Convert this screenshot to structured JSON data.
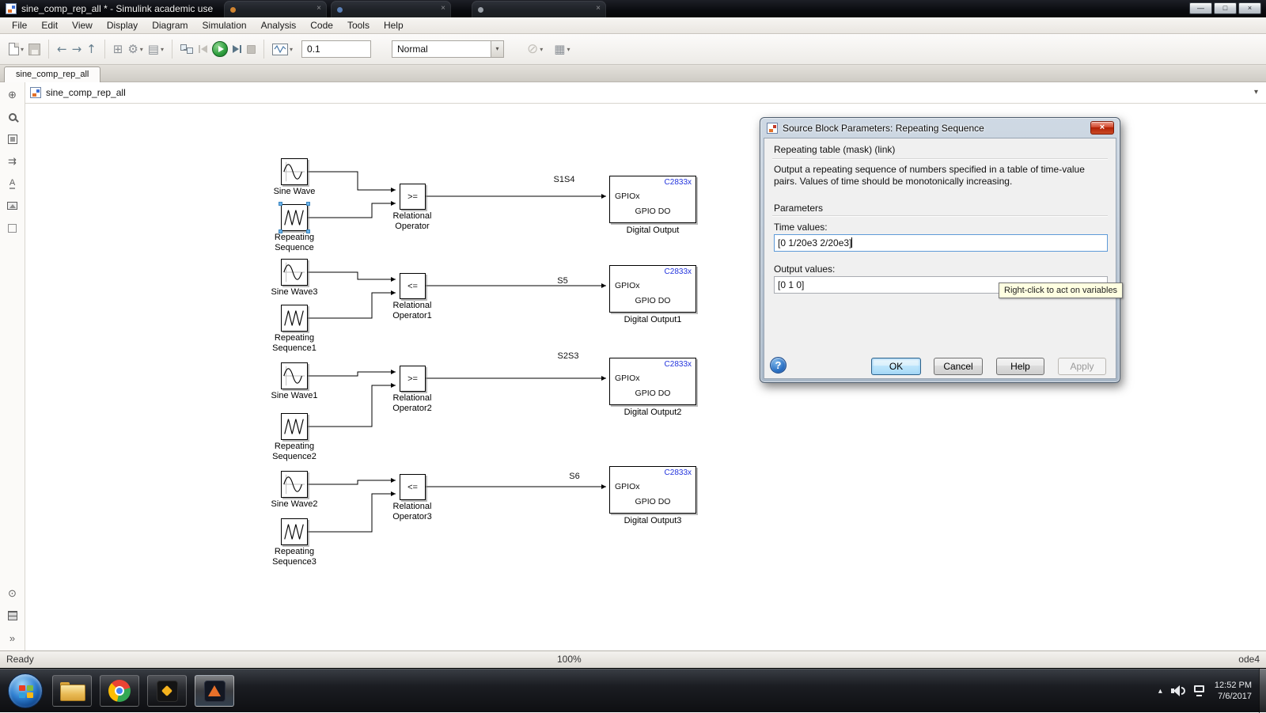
{
  "titlebar": {
    "title": "sine_comp_rep_all * - Simulink academic use"
  },
  "menu": {
    "items": [
      "File",
      "Edit",
      "View",
      "Display",
      "Diagram",
      "Simulation",
      "Analysis",
      "Code",
      "Tools",
      "Help"
    ]
  },
  "toolbar": {
    "stop_time": "0.1",
    "mode": "Normal"
  },
  "tabs": {
    "model_tab": "sine_comp_rep_all"
  },
  "breadcrumb": {
    "path": "sine_comp_rep_all"
  },
  "icons": {
    "dropdown": "▾",
    "close": "×",
    "minimize": "—",
    "maximize": "□",
    "back": "←",
    "forward": "→",
    "up": "↑",
    "gear": "⚙",
    "library": "⊞",
    "explorer": "▤",
    "build": "▦",
    "disable_circle": "⊘",
    "double_arrow": "⇉",
    "more": "»",
    "compass": "⊕",
    "viewmark": "⊙",
    "annotation": "A",
    "question": "?",
    "tray_up": "▴"
  },
  "colors": {
    "selection": "#6db3e8",
    "chip_text": "#2233dd",
    "run_button": "#2e9e3e",
    "dialog_close": "#b21e04"
  },
  "diagram": {
    "block_common": {
      "chip": "C2833x",
      "port": "GPIOx",
      "io": "GPIO DO"
    },
    "rows": [
      {
        "sine_label": "Sine Wave",
        "rep_label_1": "Repeating",
        "rep_label_2": "Sequence",
        "op": ">=",
        "op_label_1": "Relational",
        "op_label_2": "Operator",
        "signal": "S1S4",
        "out_label": "Digital Output"
      },
      {
        "sine_label": "Sine Wave3",
        "rep_label_1": "Repeating",
        "rep_label_2": "Sequence1",
        "op": "<=",
        "op_label_1": "Relational",
        "op_label_2": "Operator1",
        "signal": "S5",
        "out_label": "Digital Output1"
      },
      {
        "sine_label": "Sine Wave1",
        "rep_label_1": "Repeating",
        "rep_label_2": "Sequence2",
        "op": ">=",
        "op_label_1": "Relational",
        "op_label_2": "Operator2",
        "signal": "S2S3",
        "out_label": "Digital Output2"
      },
      {
        "sine_label": "Sine Wave2",
        "rep_label_1": "Repeating",
        "rep_label_2": "Sequence3",
        "op": "<=",
        "op_label_1": "Relational",
        "op_label_2": "Operator3",
        "signal": "S6",
        "out_label": "Digital Output3"
      }
    ]
  },
  "dialog": {
    "title": "Source Block Parameters: Repeating Sequence",
    "mask_header": "Repeating table (mask) (link)",
    "description": "Output a repeating sequence of numbers specified in a table of time-value pairs. Values of time should be monotonically increasing.",
    "parameters_heading": "Parameters",
    "time_values_label": "Time values:",
    "time_values_value": "[0 1/20e3 2/20e3]",
    "output_values_label": "Output values:",
    "output_values_value": "[0 1 0]",
    "tooltip": "Right-click to act on variables",
    "ok": "OK",
    "cancel": "Cancel",
    "help": "Help",
    "apply": "Apply"
  },
  "status": {
    "left": "Ready",
    "zoom": "100%",
    "solver": "ode4"
  },
  "taskbar": {
    "time": "12:52 PM",
    "date": "7/6/2017"
  }
}
